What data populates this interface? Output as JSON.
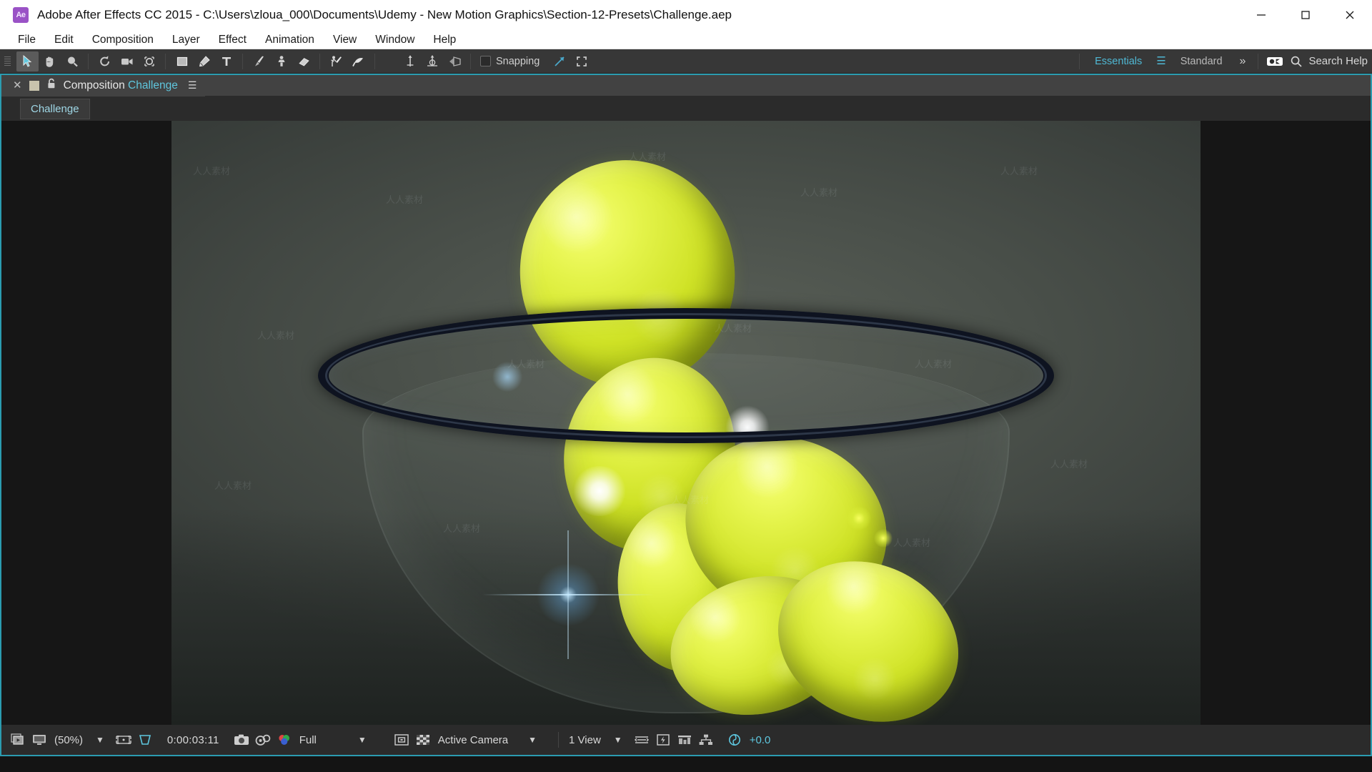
{
  "window": {
    "app_icon": "Ae",
    "title": "Adobe After Effects CC 2015 - C:\\Users\\zloua_000\\Documents\\Udemy - New Motion Graphics\\Section-12-Presets\\Challenge.aep",
    "minimize_label": "minimize-icon",
    "maximize_label": "maximize-icon",
    "close_label": "close-icon"
  },
  "menubar": {
    "items": [
      {
        "label": "File"
      },
      {
        "label": "Edit"
      },
      {
        "label": "Composition"
      },
      {
        "label": "Layer"
      },
      {
        "label": "Effect"
      },
      {
        "label": "Animation"
      },
      {
        "label": "View"
      },
      {
        "label": "Window"
      },
      {
        "label": "Help"
      }
    ]
  },
  "toolbar": {
    "tools": [
      {
        "name": "selection-tool-icon",
        "active": true
      },
      {
        "name": "hand-tool-icon",
        "active": false
      },
      {
        "name": "zoom-tool-icon",
        "active": false
      },
      {
        "name": "rotation-tool-icon",
        "active": false
      },
      {
        "name": "camera-tool-icon",
        "active": false
      },
      {
        "name": "anchor-point-tool-icon",
        "active": false
      },
      {
        "name": "shape-tool-icon",
        "active": false
      },
      {
        "name": "pen-tool-icon",
        "active": false
      },
      {
        "name": "type-tool-icon",
        "active": false
      },
      {
        "name": "brush-tool-icon",
        "active": false
      },
      {
        "name": "clone-stamp-tool-icon",
        "active": false
      },
      {
        "name": "eraser-tool-icon",
        "active": false
      },
      {
        "name": "roto-brush-tool-icon",
        "active": false
      },
      {
        "name": "puppet-pin-tool-icon",
        "active": false
      },
      {
        "name": "local-axis-mode-icon",
        "active": false
      },
      {
        "name": "world-axis-mode-icon",
        "active": false
      },
      {
        "name": "view-axis-mode-icon",
        "active": false
      }
    ],
    "snapping_label": "Snapping",
    "snapping_checked": false,
    "snap_extra_icons": [
      "snap-to-grid-icon",
      "snap-scale-icon"
    ],
    "workspaces": [
      {
        "label": "Essentials",
        "selected": true
      },
      {
        "label": "Standard",
        "selected": false
      }
    ],
    "workspace_menu_icon": "workspace-burger-icon",
    "overflow_icon": "chevron-double-right-icon",
    "sync_settings_icon": "sync-settings-icon",
    "search_icon": "search-icon",
    "search_placeholder": "Search Help"
  },
  "comp_panel": {
    "tab": {
      "close_icon": "close-icon",
      "thumbnail_icon": "composition-thumbnail-icon",
      "lock_icon": "lock-icon",
      "prefix": "Composition",
      "name": "Challenge",
      "menu_icon": "panel-menu-icon"
    },
    "sub_tabs": [
      {
        "label": "Challenge",
        "active": true
      }
    ]
  },
  "viewer": {
    "content_description": "3D render of yellow lemons falling into a glass bowl with lens flare",
    "watermarks": [
      "人人素材",
      "人人素材",
      "人人素材",
      "人人素材",
      "人人素材",
      "人人素材",
      "人人素材",
      "人人素材",
      "人人素材",
      "人人素材",
      "人人素材",
      "人人素材",
      "人人素材",
      "人人素材"
    ],
    "colors": {
      "background": "#4a504a",
      "lemon": "#d4e62b",
      "bowl_rim": "#0e1320",
      "flare": "#7ec4ff"
    }
  },
  "statusbar": {
    "always_preview_icon": "always-preview-this-view-icon",
    "main_view_icon": "main-view-icon",
    "magnification": "(50%)",
    "magnification_chevron": "chevron-down-icon",
    "region_of_interest_icon": "region-of-interest-icon",
    "transparency_grid_icon": "transparency-grid-icon",
    "timecode": "0:00:03:11",
    "snapshot_icon": "take-snapshot-icon",
    "show_snapshot_icon": "show-snapshot-icon",
    "channels_icon": "show-channel-icon",
    "resolution": "Full",
    "resolution_chevron": "chevron-down-icon",
    "guides_icon": "toggle-guides-icon",
    "masks_icon": "toggle-mask-visibility-icon",
    "camera_view": "Active Camera",
    "camera_chevron": "chevron-down-icon",
    "view_layout": "1 View",
    "view_layout_chevron": "chevron-down-icon",
    "pixel_aspect_icon": "pixel-aspect-correction-icon",
    "fast_previews_icon": "fast-previews-icon",
    "timeline_icon": "timeline-icon",
    "comp_flowchart_icon": "comp-flowchart-icon",
    "exposure_icon": "reset-exposure-icon",
    "exposure_value": "+0.0"
  }
}
